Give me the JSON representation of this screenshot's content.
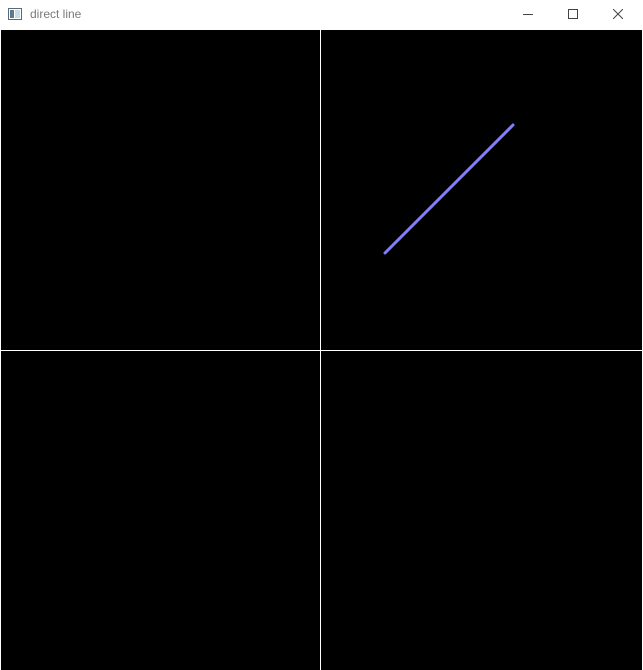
{
  "window": {
    "title": "direct line",
    "controls": {
      "minimize_icon": "minimize-icon",
      "maximize_icon": "maximize-icon",
      "close_icon": "close-icon"
    }
  },
  "canvas": {
    "background": "#000000",
    "divider_color": "#ffffff",
    "line_color": "#8080ff"
  }
}
